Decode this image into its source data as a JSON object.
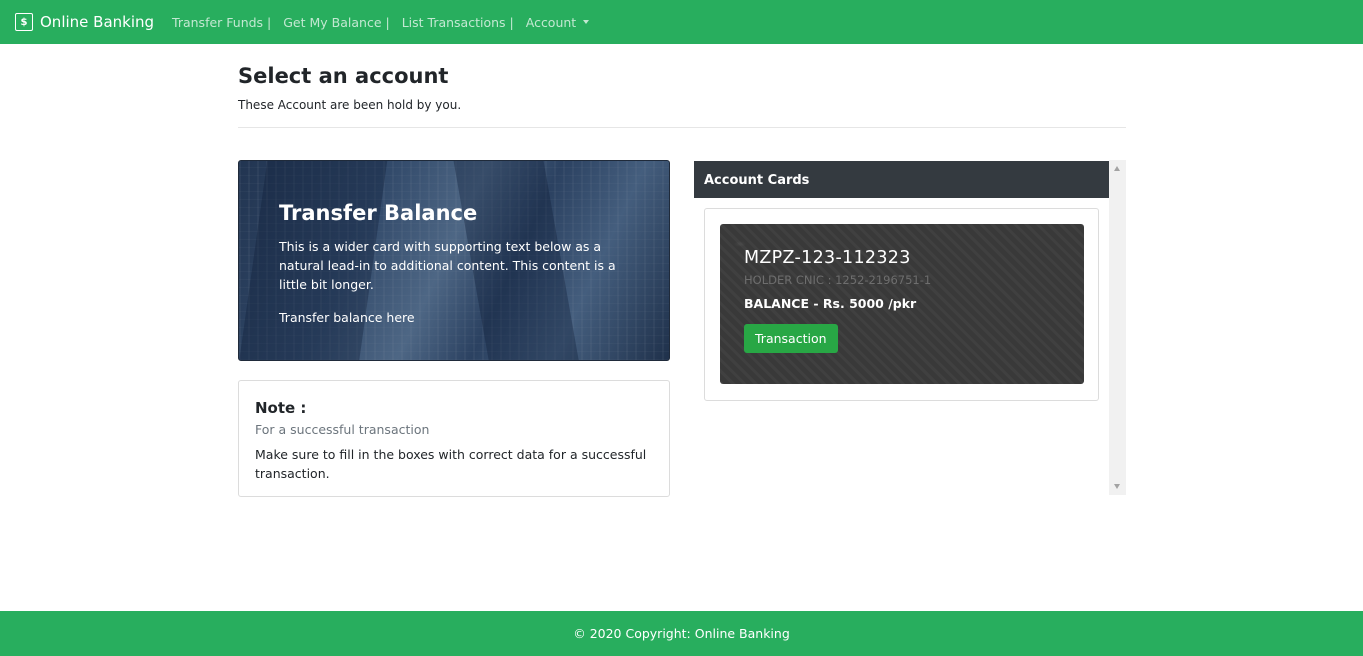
{
  "navbar": {
    "brand_icon": "$",
    "brand": "Online Banking",
    "links": [
      "Transfer Funds |",
      "Get My Balance |",
      "List Transactions |"
    ],
    "account_label": "Account",
    "bg_color": "#28ae5e"
  },
  "header": {
    "title": "Select an account",
    "subtitle": "These Account are been hold by you."
  },
  "transfer_card": {
    "title": "Transfer Balance",
    "text": "This is a wider card with supporting text below as a natural lead-in to additional content. This content is a little bit longer.",
    "link": "Transfer balance here"
  },
  "note": {
    "title": "Note :",
    "subtitle": "For a successful transaction",
    "text": "Make sure to fill in the boxes with correct data for a successful transaction."
  },
  "accounts_panel": {
    "header": "Account Cards",
    "cards": [
      {
        "number": "MZPZ-123-112323",
        "holder": "HOLDER CNIC : 1252-2196751-1",
        "balance": "BALANCE - Rs. 5000 /pkr",
        "button": "Transaction"
      }
    ]
  },
  "footer": {
    "text": "© 2020 Copyright: Online Banking"
  }
}
